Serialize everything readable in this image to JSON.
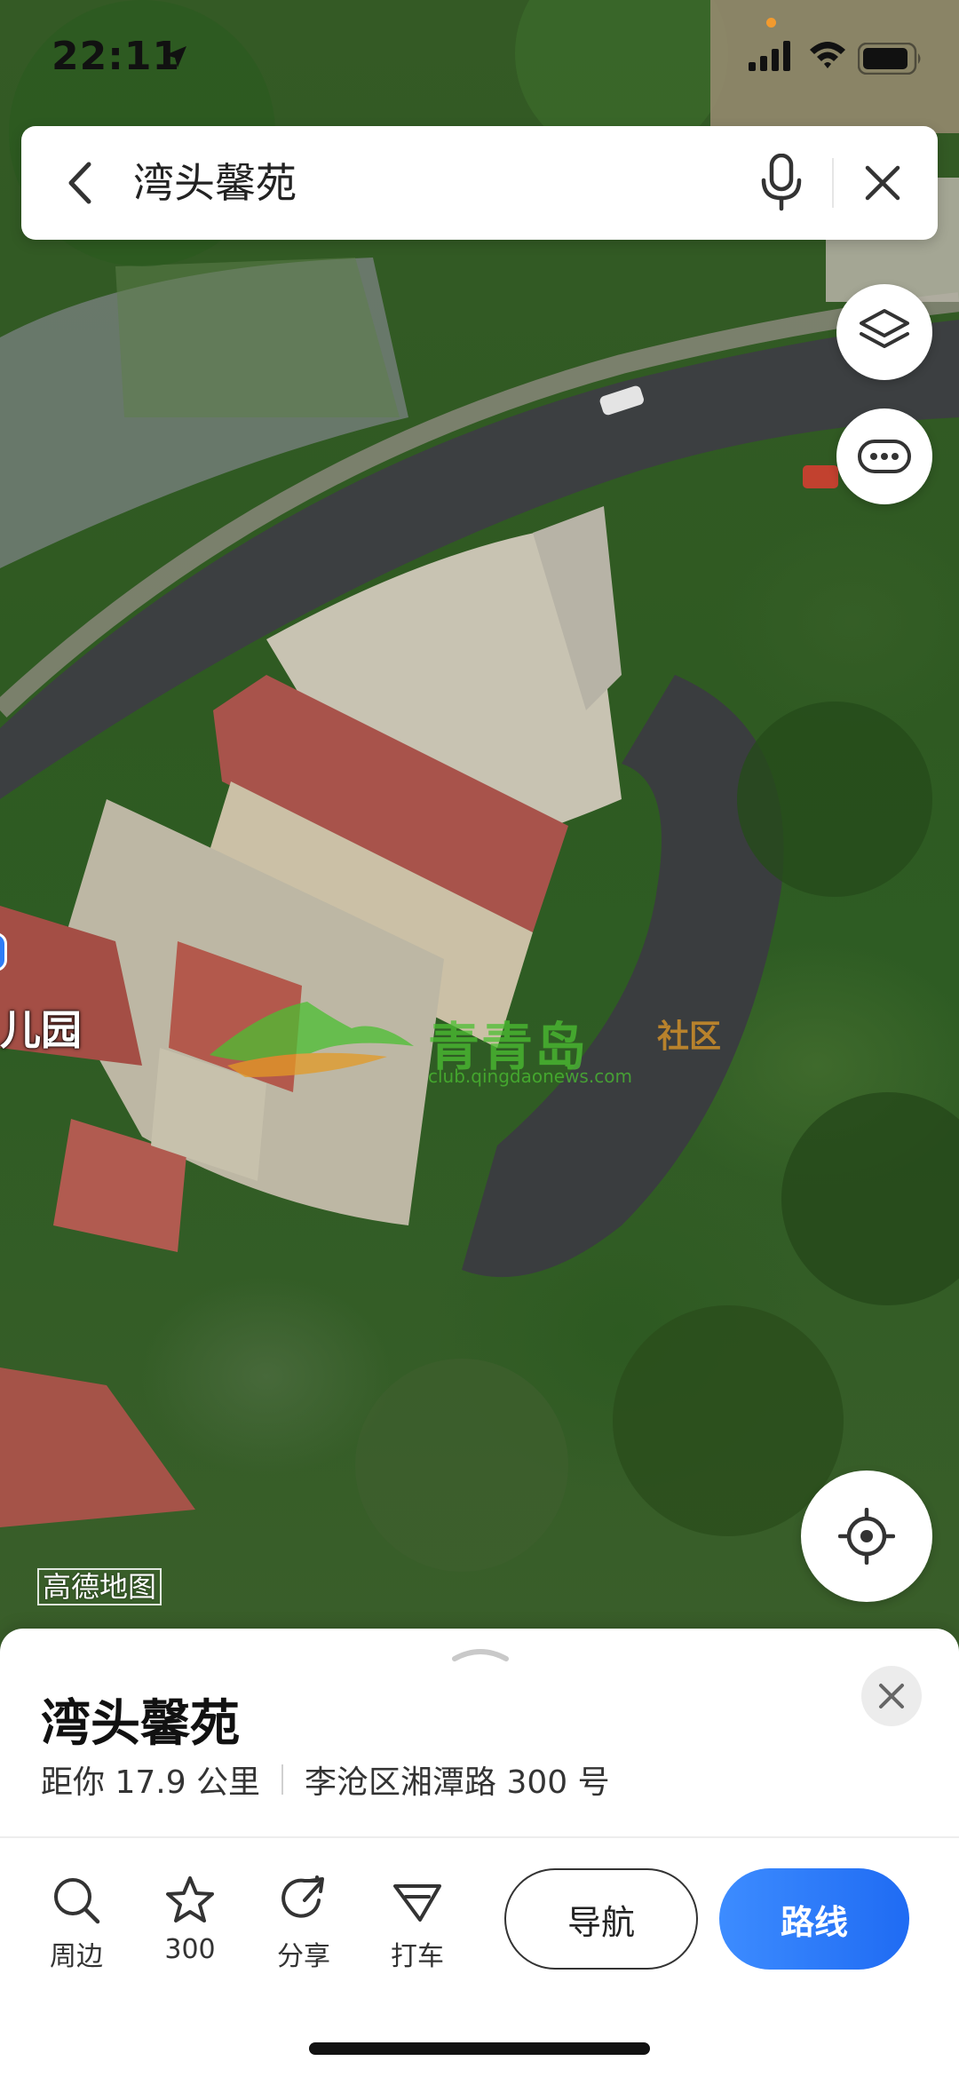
{
  "status_bar": {
    "time": "22:11"
  },
  "search": {
    "query": "湾头馨苑"
  },
  "map": {
    "poi_label": "儿园",
    "provider_logo": "高德地图",
    "watermark": {
      "brand": "青青岛",
      "suffix": "社区",
      "url": "club.qingdaonews.com"
    }
  },
  "place": {
    "name": "湾头馨苑",
    "distance": "距你 17.9 公里",
    "address": "李沧区湘潭路 300 号"
  },
  "actions": {
    "nearby": "周边",
    "favorite": "300",
    "share": "分享",
    "taxi": "打车",
    "navigate": "导航",
    "route": "路线"
  },
  "icons": [
    "location-arrow-icon",
    "signal-icon",
    "wifi-icon",
    "battery-icon",
    "back-icon",
    "mic-icon",
    "close-icon",
    "layers-icon",
    "more-icon",
    "locate-icon",
    "search-icon",
    "star-icon",
    "share-icon",
    "taxi-icon"
  ],
  "colors": {
    "primary": "#1f6bf3",
    "watermark_green": "#4bbf32",
    "watermark_orange": "#e39a26"
  }
}
